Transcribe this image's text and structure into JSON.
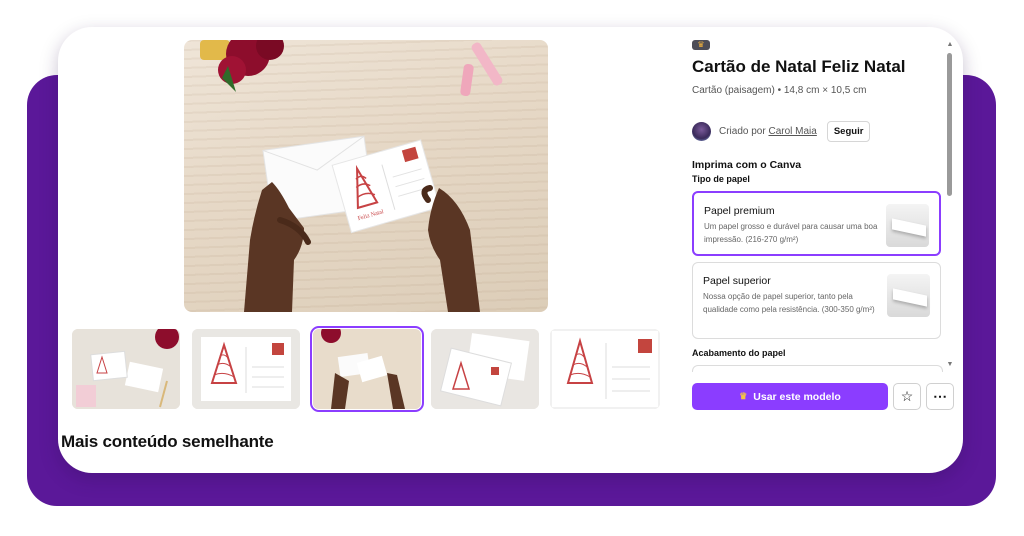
{
  "template": {
    "title": "Cartão de Natal Feliz Natal",
    "subtitle": "Cartão (paisagem) • 14,8 cm × 10,5 cm",
    "creator_prefix": "Criado por",
    "creator_name": "Carol Maia",
    "follow_label": "Seguir"
  },
  "print": {
    "heading": "Imprima com o Canva",
    "paper_type_label": "Tipo de papel",
    "options": [
      {
        "name": "Papel premium",
        "desc": "Um papel grosso e durável para causar uma boa impressão. (216-270 g/m²)",
        "selected": true
      },
      {
        "name": "Papel superior",
        "desc": "Nossa opção de papel superior, tanto pela qualidade como pela resistência. (300-350 g/m²)",
        "selected": false
      }
    ],
    "finish_label": "Acabamento do papel"
  },
  "actions": {
    "use_template_label": "Usar este modelo",
    "favorite_icon": "star-icon",
    "more_icon": "more-icon"
  },
  "card_text": "Feliz Natal",
  "more_content_title": "Mais conteúdo semelhante",
  "colors": {
    "accent": "#8b3dff",
    "frame_purple": "#5b1899"
  }
}
